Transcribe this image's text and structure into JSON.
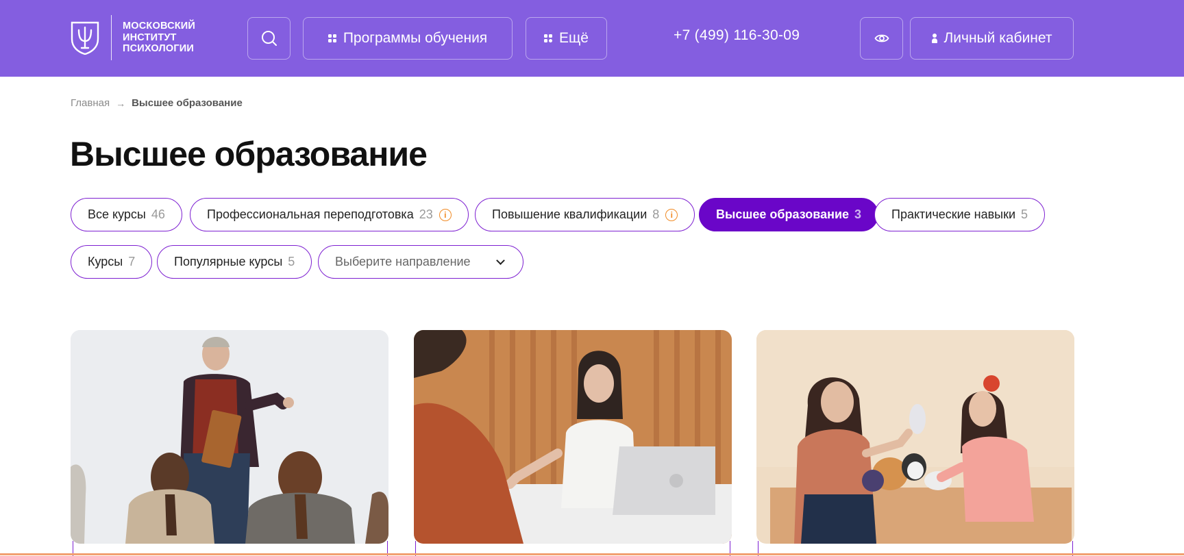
{
  "header": {
    "logo_lines": [
      "МОСКОВСКИЙ",
      "ИНСТИТУТ",
      "ПСИХОЛОГИИ"
    ],
    "programs_label": "Программы обучения",
    "more_label": "Ещё",
    "phone": "+7 (499) 116-30-09",
    "cabinet_label": "Личный кабинет",
    "icons": [
      "search-icon",
      "grid-icon",
      "eye-icon",
      "user-icon"
    ],
    "background_color": "#845EE0"
  },
  "breadcrumb": {
    "home": "Главная",
    "separator": "→",
    "current": "Высшее образование"
  },
  "page_title": "Высшее образование",
  "filters": [
    {
      "label": "Все курсы",
      "count": "46",
      "info": false,
      "active": false
    },
    {
      "label": "Профессиональная переподготовка",
      "count": "23",
      "info": true,
      "active": false
    },
    {
      "label": "Повышение квалификации",
      "count": "8",
      "info": true,
      "active": false
    },
    {
      "label": "Высшее образование",
      "count": "3",
      "info": false,
      "active": true
    },
    {
      "label": "Практические навыки",
      "count": "5",
      "info": false,
      "active": false
    },
    {
      "label": "Курсы",
      "count": "7",
      "info": false,
      "active": false
    },
    {
      "label": "Популярные курсы",
      "count": "5",
      "info": false,
      "active": false
    }
  ],
  "direction_select": {
    "placeholder": "Выберите направление"
  },
  "info_symbol": "i",
  "colors": {
    "accent": "#6A06C8",
    "chip_border": "#7D1FD1",
    "info": "#F08A24"
  },
  "cards": [
    {
      "image": "photo-lecturer-with-students"
    },
    {
      "image": "photo-psychologist-consultation"
    },
    {
      "image": "photo-child-therapy-with-toys"
    }
  ]
}
